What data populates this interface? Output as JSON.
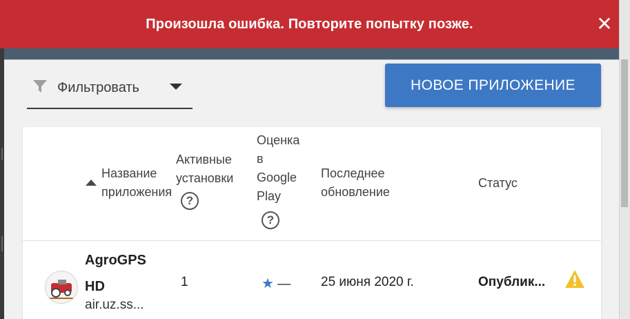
{
  "error_banner": {
    "message": "Произошла ошибка. Повторите попытку позже.",
    "close_symbol": "✕"
  },
  "toolbar": {
    "filter_label": "Фильтровать",
    "new_app_label": "НОВОЕ ПРИЛОЖЕНИЕ"
  },
  "table": {
    "columns": {
      "name_line1": "Название",
      "name_line2": "приложения",
      "installs_line1": "Активные",
      "installs_line2": "установки",
      "rating_line1": "Оценка",
      "rating_line2": "в",
      "rating_line3": "Google",
      "rating_line4": "Play",
      "updated_line1": "Последнее",
      "updated_line2": "обновление",
      "status": "Статус"
    },
    "rows": [
      {
        "name_line1": "AgroGPS",
        "name_line2": "HD",
        "package": "air.uz.ss...",
        "installs": "1",
        "rating_star": "★",
        "rating_value": "—",
        "updated": "25 июня 2020 г.",
        "status": "Опублик..."
      }
    ]
  },
  "colors": {
    "error_bg": "#c62d32",
    "primary_button": "#3d78c4",
    "warning": "#f2c12e",
    "star": "#3d78c4"
  },
  "icons": [
    "filter-icon",
    "caret-down-icon",
    "close-icon",
    "sort-ascending-icon",
    "help-icon",
    "app-icon",
    "star-icon",
    "warning-icon"
  ]
}
